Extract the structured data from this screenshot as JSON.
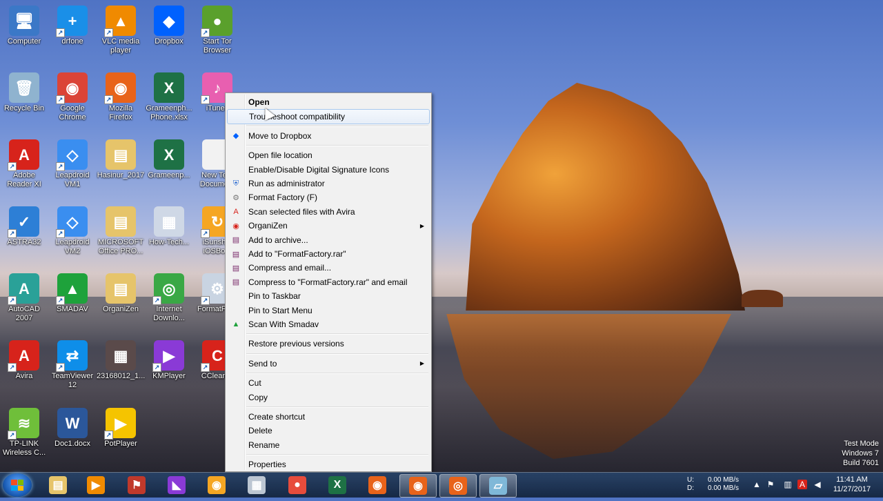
{
  "desktop": {
    "icons": [
      {
        "label": "Computer",
        "icon": "computer-icon",
        "color": "#3b78c7",
        "glyph": "🖥",
        "shortcut": false
      },
      {
        "label": "drfone",
        "icon": "drfone-icon",
        "color": "#1a8fe8",
        "glyph": "+",
        "shortcut": true
      },
      {
        "label": "VLC media player",
        "icon": "vlc-icon",
        "color": "#f08a00",
        "glyph": "▲",
        "shortcut": true
      },
      {
        "label": "Dropbox",
        "icon": "dropbox-icon",
        "color": "#0061fe",
        "glyph": "◆",
        "shortcut": false
      },
      {
        "label": "Start Tor Browser",
        "icon": "tor-icon",
        "color": "#5aa02c",
        "glyph": "●",
        "shortcut": true
      },
      {
        "label": "Recycle Bin",
        "icon": "recycle-bin-icon",
        "color": "#8fb3cf",
        "glyph": "🗑",
        "shortcut": false
      },
      {
        "label": "Google Chrome",
        "icon": "chrome-icon",
        "color": "#db4437",
        "glyph": "◉",
        "shortcut": true
      },
      {
        "label": "Mozilla Firefox",
        "icon": "firefox-icon",
        "color": "#e8631a",
        "glyph": "◉",
        "shortcut": true
      },
      {
        "label": "Grameenph... Phone.xlsx",
        "icon": "excel-file-icon",
        "color": "#1e7145",
        "glyph": "X",
        "shortcut": false
      },
      {
        "label": "iTunes",
        "icon": "itunes-icon",
        "color": "#e85fb0",
        "glyph": "♪",
        "shortcut": true
      },
      {
        "label": "Adobe Reader XI",
        "icon": "adobe-reader-icon",
        "color": "#d7231b",
        "glyph": "A",
        "shortcut": true
      },
      {
        "label": "Leapdroid VM1",
        "icon": "leapdroid-icon",
        "color": "#3a8ef0",
        "glyph": "◇",
        "shortcut": true
      },
      {
        "label": "Hasinur_2017",
        "icon": "folder-icon",
        "color": "#e6c46a",
        "glyph": "▤",
        "shortcut": false
      },
      {
        "label": "Grameenp...",
        "icon": "excel-file-icon",
        "color": "#1e7145",
        "glyph": "X",
        "shortcut": false
      },
      {
        "label": "New Te... Docume...",
        "icon": "text-document-icon",
        "color": "#f2f2f2",
        "glyph": "",
        "shortcut": false
      },
      {
        "label": "ASTRA32",
        "icon": "astra32-icon",
        "color": "#2d7fd6",
        "glyph": "✓",
        "shortcut": true
      },
      {
        "label": "Leapdroid VM2",
        "icon": "leapdroid-icon",
        "color": "#3a8ef0",
        "glyph": "◇",
        "shortcut": true
      },
      {
        "label": "MICROSOFT Office PRO...",
        "icon": "folder-icon",
        "color": "#e6c46a",
        "glyph": "▤",
        "shortcut": false
      },
      {
        "label": "How-Tech...",
        "icon": "image-file-icon",
        "color": "#cfd8e6",
        "glyph": "▦",
        "shortcut": false
      },
      {
        "label": "iSunsh... iOSBo...",
        "icon": "isunshare-icon",
        "color": "#f5a623",
        "glyph": "↻",
        "shortcut": true
      },
      {
        "label": "AutoCAD 2007",
        "icon": "autocad-icon",
        "color": "#2aa198",
        "glyph": "A",
        "shortcut": true
      },
      {
        "label": "SMADAV",
        "icon": "smadav-icon",
        "color": "#1ea23b",
        "glyph": "▲",
        "shortcut": true
      },
      {
        "label": "OrganiZen",
        "icon": "folder-icon",
        "color": "#e6c46a",
        "glyph": "▤",
        "shortcut": false
      },
      {
        "label": "Internet Downlo...",
        "icon": "idm-icon",
        "color": "#3aa845",
        "glyph": "◎",
        "shortcut": true
      },
      {
        "label": "FormatF... y",
        "icon": "formatfactory-icon",
        "color": "#c9d4e2",
        "glyph": "⚙",
        "shortcut": true
      },
      {
        "label": "Avira",
        "icon": "avira-icon",
        "color": "#d7231b",
        "glyph": "A",
        "shortcut": true
      },
      {
        "label": "TeamViewer 12",
        "icon": "teamviewer-icon",
        "color": "#0e8ee9",
        "glyph": "⇄",
        "shortcut": true
      },
      {
        "label": "23168012_1...",
        "icon": "image-file-icon",
        "color": "#5a4a4a",
        "glyph": "▦",
        "shortcut": false
      },
      {
        "label": "KMPlayer",
        "icon": "kmplayer-icon",
        "color": "#8a3ad6",
        "glyph": "▶",
        "shortcut": true
      },
      {
        "label": "CCleaner",
        "icon": "ccleaner-icon",
        "color": "#d7231b",
        "glyph": "C",
        "shortcut": true
      },
      {
        "label": "TP-LINK Wireless C...",
        "icon": "tplink-icon",
        "color": "#6fbf3a",
        "glyph": "≋",
        "shortcut": true
      },
      {
        "label": "Doc1.docx",
        "icon": "word-file-icon",
        "color": "#2b579a",
        "glyph": "W",
        "shortcut": false
      },
      {
        "label": "PotPlayer",
        "icon": "potplayer-icon",
        "color": "#f5c400",
        "glyph": "▶",
        "shortcut": true
      }
    ]
  },
  "context_menu": {
    "items": [
      {
        "type": "item",
        "label": "Open",
        "bold": true,
        "icon": "",
        "sub": false
      },
      {
        "type": "item",
        "label": "Troubleshoot compatibility",
        "hover": true,
        "icon": "",
        "sub": false
      },
      {
        "type": "sep"
      },
      {
        "type": "item",
        "label": "Move to Dropbox",
        "icon": "dropbox-icon",
        "glyph": "◆",
        "color": "#0061fe",
        "sub": false
      },
      {
        "type": "sep"
      },
      {
        "type": "item",
        "label": "Open file location",
        "icon": "",
        "sub": false
      },
      {
        "type": "item",
        "label": "Enable/Disable Digital Signature Icons",
        "icon": "",
        "sub": false
      },
      {
        "type": "item",
        "label": "Run as administrator",
        "icon": "uac-shield-icon",
        "glyph": "⛨",
        "color": "#2a6bd1",
        "sub": false
      },
      {
        "type": "item",
        "label": "Format Factory (F)",
        "icon": "formatfactory-icon",
        "glyph": "⚙",
        "color": "#777777",
        "sub": false
      },
      {
        "type": "item",
        "label": "Scan selected files with Avira",
        "icon": "avira-icon",
        "glyph": "A",
        "color": "#d7231b",
        "sub": false
      },
      {
        "type": "item",
        "label": "OrganiZen",
        "icon": "organizen-icon",
        "glyph": "◉",
        "color": "#d7231b",
        "sub": true
      },
      {
        "type": "item",
        "label": "Add to archive...",
        "icon": "winrar-icon",
        "glyph": "▤",
        "color": "#7a2a6a",
        "sub": false
      },
      {
        "type": "item",
        "label": "Add to \"FormatFactory.rar\"",
        "icon": "winrar-icon",
        "glyph": "▤",
        "color": "#7a2a6a",
        "sub": false
      },
      {
        "type": "item",
        "label": "Compress and email...",
        "icon": "winrar-icon",
        "glyph": "▤",
        "color": "#7a2a6a",
        "sub": false
      },
      {
        "type": "item",
        "label": "Compress to \"FormatFactory.rar\" and email",
        "icon": "winrar-icon",
        "glyph": "▤",
        "color": "#7a2a6a",
        "sub": false
      },
      {
        "type": "item",
        "label": "Pin to Taskbar",
        "icon": "",
        "sub": false
      },
      {
        "type": "item",
        "label": "Pin to Start Menu",
        "icon": "",
        "sub": false
      },
      {
        "type": "item",
        "label": "Scan With Smadav",
        "icon": "smadav-icon",
        "glyph": "▲",
        "color": "#1ea23b",
        "sub": false
      },
      {
        "type": "sep"
      },
      {
        "type": "item",
        "label": "Restore previous versions",
        "icon": "",
        "sub": false
      },
      {
        "type": "sep"
      },
      {
        "type": "item",
        "label": "Send to",
        "icon": "",
        "sub": true
      },
      {
        "type": "sep"
      },
      {
        "type": "item",
        "label": "Cut",
        "icon": "",
        "sub": false
      },
      {
        "type": "item",
        "label": "Copy",
        "icon": "",
        "sub": false
      },
      {
        "type": "sep"
      },
      {
        "type": "item",
        "label": "Create shortcut",
        "icon": "",
        "sub": false
      },
      {
        "type": "item",
        "label": "Delete",
        "icon": "",
        "sub": false
      },
      {
        "type": "item",
        "label": "Rename",
        "icon": "",
        "sub": false
      },
      {
        "type": "sep"
      },
      {
        "type": "item",
        "label": "Properties",
        "icon": "",
        "sub": false
      }
    ]
  },
  "watermark": {
    "line1": "Test Mode",
    "line2": "Windows 7",
    "line3": "Build 7601"
  },
  "taskbar": {
    "apps": [
      {
        "name": "explorer",
        "icon": "folder-icon",
        "glyph": "▤",
        "color": "#e6c46a"
      },
      {
        "name": "media-player",
        "icon": "media-player-icon",
        "glyph": "▶",
        "color": "#f08a00"
      },
      {
        "name": "game",
        "icon": "game-icon",
        "glyph": "⚑",
        "color": "#c0392b"
      },
      {
        "name": "visual-studio",
        "icon": "visual-studio-icon",
        "glyph": "◣",
        "color": "#8a3ad6"
      },
      {
        "name": "app-orange",
        "icon": "app-icon",
        "glyph": "◉",
        "color": "#f5a623"
      },
      {
        "name": "calculator",
        "icon": "calculator-icon",
        "glyph": "▦",
        "color": "#bcc6d2"
      },
      {
        "name": "app-red",
        "icon": "app-icon",
        "glyph": "●",
        "color": "#e74c3c"
      },
      {
        "name": "excel",
        "icon": "excel-icon",
        "glyph": "X",
        "color": "#1e7145"
      },
      {
        "name": "firefox",
        "icon": "firefox-icon",
        "glyph": "◉",
        "color": "#e8631a"
      },
      {
        "name": "firefox-active",
        "icon": "firefox-icon",
        "glyph": "◉",
        "color": "#e8631a",
        "active": true
      },
      {
        "name": "screen-recorder",
        "icon": "screen-recorder-icon",
        "glyph": "◎",
        "color": "#e8631a",
        "active": true
      },
      {
        "name": "windows-explorer",
        "icon": "window-icon",
        "glyph": "▱",
        "color": "#7fb8d8",
        "active": true
      }
    ],
    "network": {
      "up_label": "U:",
      "up_value": "0.00 MB/s",
      "down_label": "D:",
      "down_value": "0.00 MB/s"
    },
    "clock": {
      "time": "11:41 AM",
      "date": "11/27/2017"
    }
  }
}
